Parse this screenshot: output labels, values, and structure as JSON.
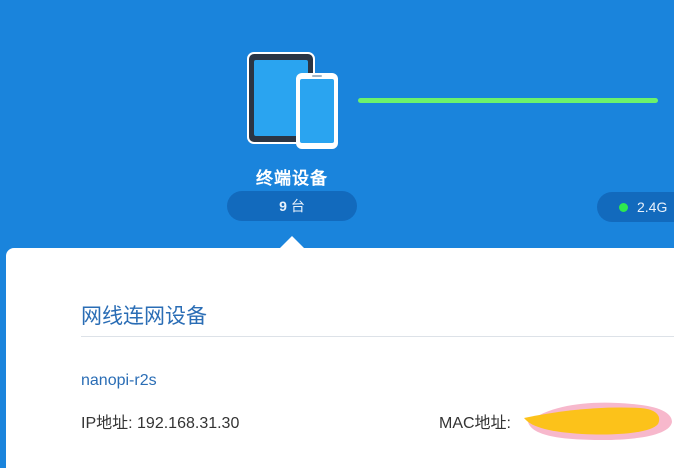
{
  "terminal": {
    "title": "终端设备",
    "count": "9",
    "count_unit": "台",
    "icon": "tablet-phone-icon"
  },
  "band": {
    "label": "2.4G",
    "status_color": "#2ee84f"
  },
  "colors": {
    "background": "#1a84dc",
    "connection_line": "#6cf26c",
    "accent_text": "#2a6db5"
  },
  "section": {
    "title": "网线连网设备"
  },
  "device": {
    "name": "nanopi-r2s",
    "ip_label": "IP地址:",
    "ip_value": "192.168.31.30",
    "mac_label": "MAC地址:"
  }
}
